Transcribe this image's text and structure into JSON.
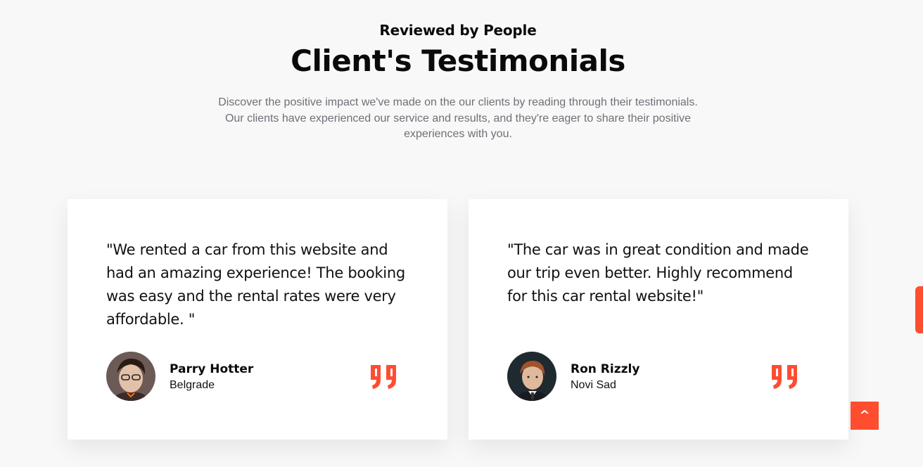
{
  "section": {
    "subtitle": "Reviewed by People",
    "title": "Client's Testimonials",
    "description": "Discover the positive impact we've made on the our clients by reading through their testimonials. Our clients have experienced our service and results, and they're eager to share their positive experiences with you."
  },
  "testimonials": [
    {
      "quote": "\"We rented a car from this website and had an amazing experience! The booking was easy and the rental rates were very affordable. \"",
      "name": "Parry Hotter",
      "city": "Belgrade"
    },
    {
      "quote": "\"The car was in great condition and made our trip even better. Highly recommend for this car rental website!\"",
      "name": "Ron Rizzly",
      "city": "Novi Sad"
    }
  ],
  "scroll_top_label": "^",
  "colors": {
    "accent": "#ff4d30",
    "background": "#f8f8f8",
    "card": "#ffffff",
    "text": "#0a0a0a",
    "muted": "#6f6f78"
  },
  "icons": {
    "quote": "quote-icon",
    "scroll_top": "chevron-up-icon"
  }
}
